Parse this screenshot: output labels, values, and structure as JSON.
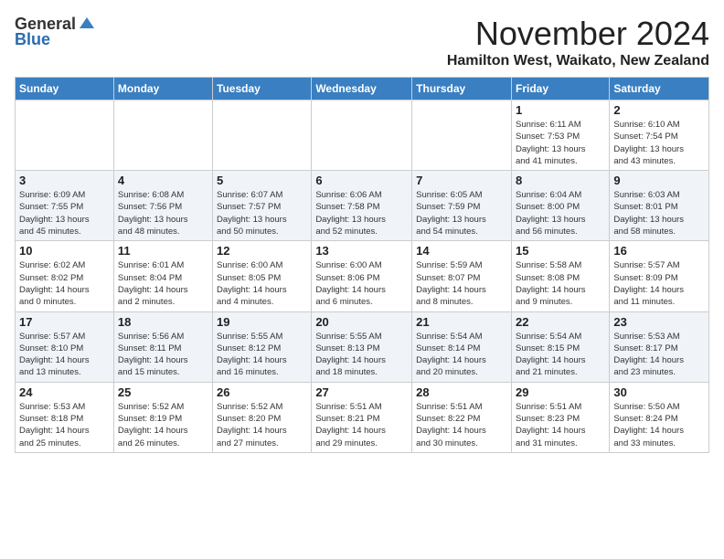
{
  "header": {
    "logo_general": "General",
    "logo_blue": "Blue",
    "month": "November 2024",
    "location": "Hamilton West, Waikato, New Zealand"
  },
  "weekdays": [
    "Sunday",
    "Monday",
    "Tuesday",
    "Wednesday",
    "Thursday",
    "Friday",
    "Saturday"
  ],
  "weeks": [
    [
      {
        "day": "",
        "info": ""
      },
      {
        "day": "",
        "info": ""
      },
      {
        "day": "",
        "info": ""
      },
      {
        "day": "",
        "info": ""
      },
      {
        "day": "",
        "info": ""
      },
      {
        "day": "1",
        "info": "Sunrise: 6:11 AM\nSunset: 7:53 PM\nDaylight: 13 hours\nand 41 minutes."
      },
      {
        "day": "2",
        "info": "Sunrise: 6:10 AM\nSunset: 7:54 PM\nDaylight: 13 hours\nand 43 minutes."
      }
    ],
    [
      {
        "day": "3",
        "info": "Sunrise: 6:09 AM\nSunset: 7:55 PM\nDaylight: 13 hours\nand 45 minutes."
      },
      {
        "day": "4",
        "info": "Sunrise: 6:08 AM\nSunset: 7:56 PM\nDaylight: 13 hours\nand 48 minutes."
      },
      {
        "day": "5",
        "info": "Sunrise: 6:07 AM\nSunset: 7:57 PM\nDaylight: 13 hours\nand 50 minutes."
      },
      {
        "day": "6",
        "info": "Sunrise: 6:06 AM\nSunset: 7:58 PM\nDaylight: 13 hours\nand 52 minutes."
      },
      {
        "day": "7",
        "info": "Sunrise: 6:05 AM\nSunset: 7:59 PM\nDaylight: 13 hours\nand 54 minutes."
      },
      {
        "day": "8",
        "info": "Sunrise: 6:04 AM\nSunset: 8:00 PM\nDaylight: 13 hours\nand 56 minutes."
      },
      {
        "day": "9",
        "info": "Sunrise: 6:03 AM\nSunset: 8:01 PM\nDaylight: 13 hours\nand 58 minutes."
      }
    ],
    [
      {
        "day": "10",
        "info": "Sunrise: 6:02 AM\nSunset: 8:02 PM\nDaylight: 14 hours\nand 0 minutes."
      },
      {
        "day": "11",
        "info": "Sunrise: 6:01 AM\nSunset: 8:04 PM\nDaylight: 14 hours\nand 2 minutes."
      },
      {
        "day": "12",
        "info": "Sunrise: 6:00 AM\nSunset: 8:05 PM\nDaylight: 14 hours\nand 4 minutes."
      },
      {
        "day": "13",
        "info": "Sunrise: 6:00 AM\nSunset: 8:06 PM\nDaylight: 14 hours\nand 6 minutes."
      },
      {
        "day": "14",
        "info": "Sunrise: 5:59 AM\nSunset: 8:07 PM\nDaylight: 14 hours\nand 8 minutes."
      },
      {
        "day": "15",
        "info": "Sunrise: 5:58 AM\nSunset: 8:08 PM\nDaylight: 14 hours\nand 9 minutes."
      },
      {
        "day": "16",
        "info": "Sunrise: 5:57 AM\nSunset: 8:09 PM\nDaylight: 14 hours\nand 11 minutes."
      }
    ],
    [
      {
        "day": "17",
        "info": "Sunrise: 5:57 AM\nSunset: 8:10 PM\nDaylight: 14 hours\nand 13 minutes."
      },
      {
        "day": "18",
        "info": "Sunrise: 5:56 AM\nSunset: 8:11 PM\nDaylight: 14 hours\nand 15 minutes."
      },
      {
        "day": "19",
        "info": "Sunrise: 5:55 AM\nSunset: 8:12 PM\nDaylight: 14 hours\nand 16 minutes."
      },
      {
        "day": "20",
        "info": "Sunrise: 5:55 AM\nSunset: 8:13 PM\nDaylight: 14 hours\nand 18 minutes."
      },
      {
        "day": "21",
        "info": "Sunrise: 5:54 AM\nSunset: 8:14 PM\nDaylight: 14 hours\nand 20 minutes."
      },
      {
        "day": "22",
        "info": "Sunrise: 5:54 AM\nSunset: 8:15 PM\nDaylight: 14 hours\nand 21 minutes."
      },
      {
        "day": "23",
        "info": "Sunrise: 5:53 AM\nSunset: 8:17 PM\nDaylight: 14 hours\nand 23 minutes."
      }
    ],
    [
      {
        "day": "24",
        "info": "Sunrise: 5:53 AM\nSunset: 8:18 PM\nDaylight: 14 hours\nand 25 minutes."
      },
      {
        "day": "25",
        "info": "Sunrise: 5:52 AM\nSunset: 8:19 PM\nDaylight: 14 hours\nand 26 minutes."
      },
      {
        "day": "26",
        "info": "Sunrise: 5:52 AM\nSunset: 8:20 PM\nDaylight: 14 hours\nand 27 minutes."
      },
      {
        "day": "27",
        "info": "Sunrise: 5:51 AM\nSunset: 8:21 PM\nDaylight: 14 hours\nand 29 minutes."
      },
      {
        "day": "28",
        "info": "Sunrise: 5:51 AM\nSunset: 8:22 PM\nDaylight: 14 hours\nand 30 minutes."
      },
      {
        "day": "29",
        "info": "Sunrise: 5:51 AM\nSunset: 8:23 PM\nDaylight: 14 hours\nand 31 minutes."
      },
      {
        "day": "30",
        "info": "Sunrise: 5:50 AM\nSunset: 8:24 PM\nDaylight: 14 hours\nand 33 minutes."
      }
    ]
  ]
}
